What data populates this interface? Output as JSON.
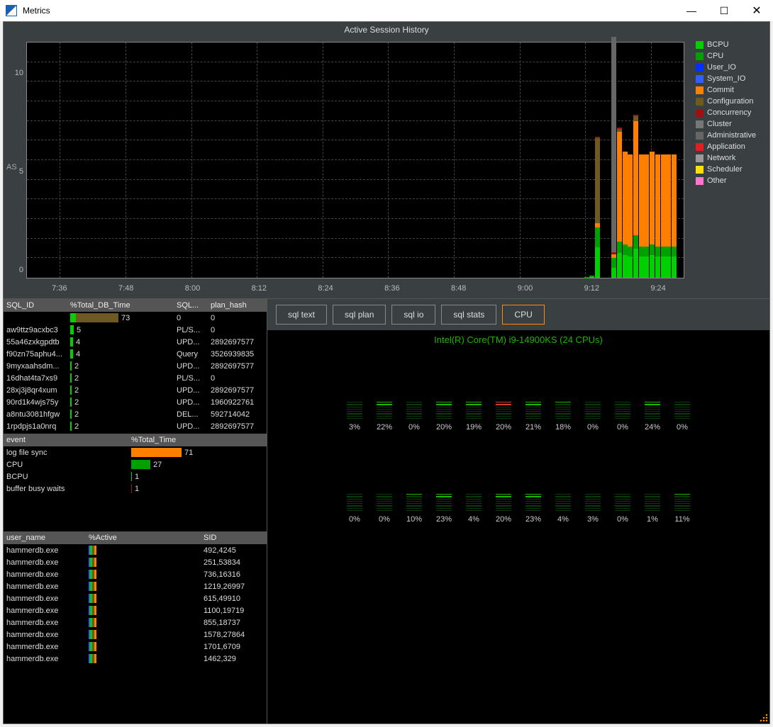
{
  "window": {
    "title": "Metrics"
  },
  "chart": {
    "title": "Active Session History",
    "ylabel": "AS",
    "yticks": [
      0,
      5,
      10
    ],
    "ymax": 12,
    "xticks": [
      "7:36",
      "7:48",
      "8:00",
      "8:12",
      "8:24",
      "8:36",
      "8:48",
      "9:00",
      "9:12",
      "9:24"
    ],
    "legend": [
      {
        "name": "BCPU",
        "color": "#00d000"
      },
      {
        "name": "CPU",
        "color": "#00a000"
      },
      {
        "name": "User_IO",
        "color": "#0030ff"
      },
      {
        "name": "System_IO",
        "color": "#2f5fff"
      },
      {
        "name": "Commit",
        "color": "#ff7f00"
      },
      {
        "name": "Configuration",
        "color": "#6e5a1e"
      },
      {
        "name": "Concurrency",
        "color": "#a01010"
      },
      {
        "name": "Cluster",
        "color": "#777"
      },
      {
        "name": "Administrative",
        "color": "#666"
      },
      {
        "name": "Application",
        "color": "#e02020"
      },
      {
        "name": "Network",
        "color": "#999"
      },
      {
        "name": "Scheduler",
        "color": "#ffe000"
      },
      {
        "name": "Other",
        "color": "#ff77cc"
      }
    ]
  },
  "chart_data": {
    "type": "bar",
    "title": "Active Session History",
    "xlabel": "",
    "ylabel": "AS",
    "ylim": [
      0,
      12
    ],
    "x": [
      "9:10",
      "9:11",
      "9:12",
      "9:13",
      "9:14",
      "9:15",
      "9:16",
      "9:17",
      "9:18",
      "9:19",
      "9:20",
      "9:21",
      "9:22",
      "9:23",
      "9:24",
      "9:25",
      "9:26",
      "9:27"
    ],
    "series": [
      {
        "name": "BCPU",
        "color": "#00d000",
        "values": [
          0,
          0.2,
          0.5,
          2.0,
          0,
          0,
          0.5,
          1.6,
          1.6,
          1.5,
          1.8,
          1.5,
          1.5,
          1.6,
          1.5,
          1.5,
          1.5,
          1.5
        ]
      },
      {
        "name": "CPU",
        "color": "#00a000",
        "values": [
          0,
          0.4,
          0.6,
          1.3,
          0,
          0,
          0.5,
          0.7,
          0.7,
          0.7,
          0.8,
          0.7,
          0.7,
          0.7,
          0.7,
          0.7,
          0.7,
          0.7
        ]
      },
      {
        "name": "Commit",
        "color": "#ff7f00",
        "values": [
          0,
          0,
          0,
          0.3,
          0,
          0,
          0.2,
          7.0,
          6.5,
          6.5,
          7.0,
          6.5,
          6.5,
          6.5,
          6.5,
          6.5,
          6.5,
          6.5
        ]
      },
      {
        "name": "Configuration",
        "color": "#6e5a1e",
        "values": [
          0,
          0,
          0,
          5.6,
          0,
          0,
          0,
          0.2,
          0,
          0,
          0.3,
          0,
          0,
          0,
          0,
          0,
          0,
          0
        ]
      },
      {
        "name": "Concurrency",
        "color": "#a01010",
        "values": [
          0,
          0.1,
          0.1,
          0.1,
          0,
          0,
          0.1,
          0.1,
          0,
          0,
          0.1,
          0,
          0,
          0,
          0,
          0,
          0,
          0
        ]
      },
      {
        "name": "Administrative",
        "color": "#666",
        "values": [
          0,
          0,
          0,
          0,
          0,
          0,
          11.0,
          0,
          0,
          0,
          0,
          0,
          0,
          0,
          0,
          0,
          0,
          0
        ]
      }
    ]
  },
  "sql_table": {
    "headers": {
      "id": "SQL_ID",
      "pct": "%Total_DB_Time",
      "sqlt": "SQL...",
      "plan": "plan_hash"
    },
    "rows": [
      {
        "id": "",
        "pct": 73,
        "sqlt": "0",
        "plan": "0",
        "colors": [
          [
            "#00d000",
            8
          ],
          [
            "#6e5a1e",
            60
          ]
        ]
      },
      {
        "id": "aw9ttz9acxbc3",
        "pct": 5,
        "sqlt": "PL/S...",
        "plan": "0",
        "colors": [
          [
            "#00d000",
            5
          ]
        ]
      },
      {
        "id": "55a46zxkgpdtb",
        "pct": 4,
        "sqlt": "UPD...",
        "plan": "2892697577",
        "colors": [
          [
            "#00d000",
            4
          ]
        ]
      },
      {
        "id": "f90zn75aphu4...",
        "pct": 4,
        "sqlt": "Query",
        "plan": "3526939835",
        "colors": [
          [
            "#00d000",
            4
          ]
        ]
      },
      {
        "id": "9myxaahsdm...",
        "pct": 2,
        "sqlt": "UPD...",
        "plan": "2892697577",
        "colors": [
          [
            "#00d000",
            2
          ]
        ]
      },
      {
        "id": "16dhat4ta7xs9",
        "pct": 2,
        "sqlt": "PL/S...",
        "plan": "0",
        "colors": [
          [
            "#00d000",
            2
          ]
        ]
      },
      {
        "id": "28xj3j8qr4xum",
        "pct": 2,
        "sqlt": "UPD...",
        "plan": "2892697577",
        "colors": [
          [
            "#00d000",
            2
          ]
        ]
      },
      {
        "id": "90rd1k4wjs75y",
        "pct": 2,
        "sqlt": "UPD...",
        "plan": "1960922761",
        "colors": [
          [
            "#00d000",
            2
          ]
        ]
      },
      {
        "id": "a8ntu3081hfgw",
        "pct": 2,
        "sqlt": "DEL...",
        "plan": "592714042",
        "colors": [
          [
            "#00d000",
            2
          ]
        ]
      },
      {
        "id": "1rpdpjs1a0nrq",
        "pct": 2,
        "sqlt": "UPD...",
        "plan": "2892697577",
        "colors": [
          [
            "#00d000",
            2
          ]
        ]
      }
    ]
  },
  "event_table": {
    "headers": {
      "name": "event",
      "pct": "%Total_Time"
    },
    "rows": [
      {
        "name": "log file sync",
        "pct": 71,
        "color": "#ff7f00"
      },
      {
        "name": "CPU",
        "pct": 27,
        "color": "#00a000"
      },
      {
        "name": "BCPU",
        "pct": 1,
        "color": "#00d000"
      },
      {
        "name": "buffer busy waits",
        "pct": 1,
        "color": "#a01010"
      }
    ]
  },
  "user_table": {
    "headers": {
      "name": "user_name",
      "act": "%Active",
      "sid": "SID"
    },
    "rows": [
      {
        "name": "hammerdb.exe",
        "sid": "492,4245"
      },
      {
        "name": "hammerdb.exe",
        "sid": "251,53834"
      },
      {
        "name": "hammerdb.exe",
        "sid": "736,16316"
      },
      {
        "name": "hammerdb.exe",
        "sid": "1219,26997"
      },
      {
        "name": "hammerdb.exe",
        "sid": "615,49910"
      },
      {
        "name": "hammerdb.exe",
        "sid": "1100,19719"
      },
      {
        "name": "hammerdb.exe",
        "sid": "855,18737"
      },
      {
        "name": "hammerdb.exe",
        "sid": "1578,27864"
      },
      {
        "name": "hammerdb.exe",
        "sid": "1701,6709"
      },
      {
        "name": "hammerdb.exe",
        "sid": "1462,329"
      }
    ],
    "bar_colors": [
      [
        "#2f5fff",
        2
      ],
      [
        "#00d000",
        3
      ],
      [
        "#6e5a1e",
        3
      ],
      [
        "#ff7f00",
        3
      ]
    ]
  },
  "tabs": [
    "sql text",
    "sql plan",
    "sql io",
    "sql stats",
    "CPU"
  ],
  "active_tab": "CPU",
  "cpu": {
    "title": "Intel(R) Core(TM) i9-14900KS (24 CPUs)",
    "rows": [
      [
        "3%",
        "22%",
        "0%",
        "20%",
        "19%",
        "20%",
        "21%",
        "18%",
        "0%",
        "0%",
        "24%",
        "0%"
      ],
      [
        "0%",
        "0%",
        "10%",
        "23%",
        "4%",
        "20%",
        "23%",
        "4%",
        "3%",
        "0%",
        "1%",
        "11%"
      ]
    ],
    "values": [
      [
        3,
        22,
        0,
        20,
        19,
        20,
        21,
        18,
        0,
        0,
        24,
        0
      ],
      [
        0,
        0,
        10,
        23,
        4,
        20,
        23,
        4,
        3,
        0,
        1,
        11
      ]
    ],
    "warn_core": [
      0,
      5
    ]
  }
}
